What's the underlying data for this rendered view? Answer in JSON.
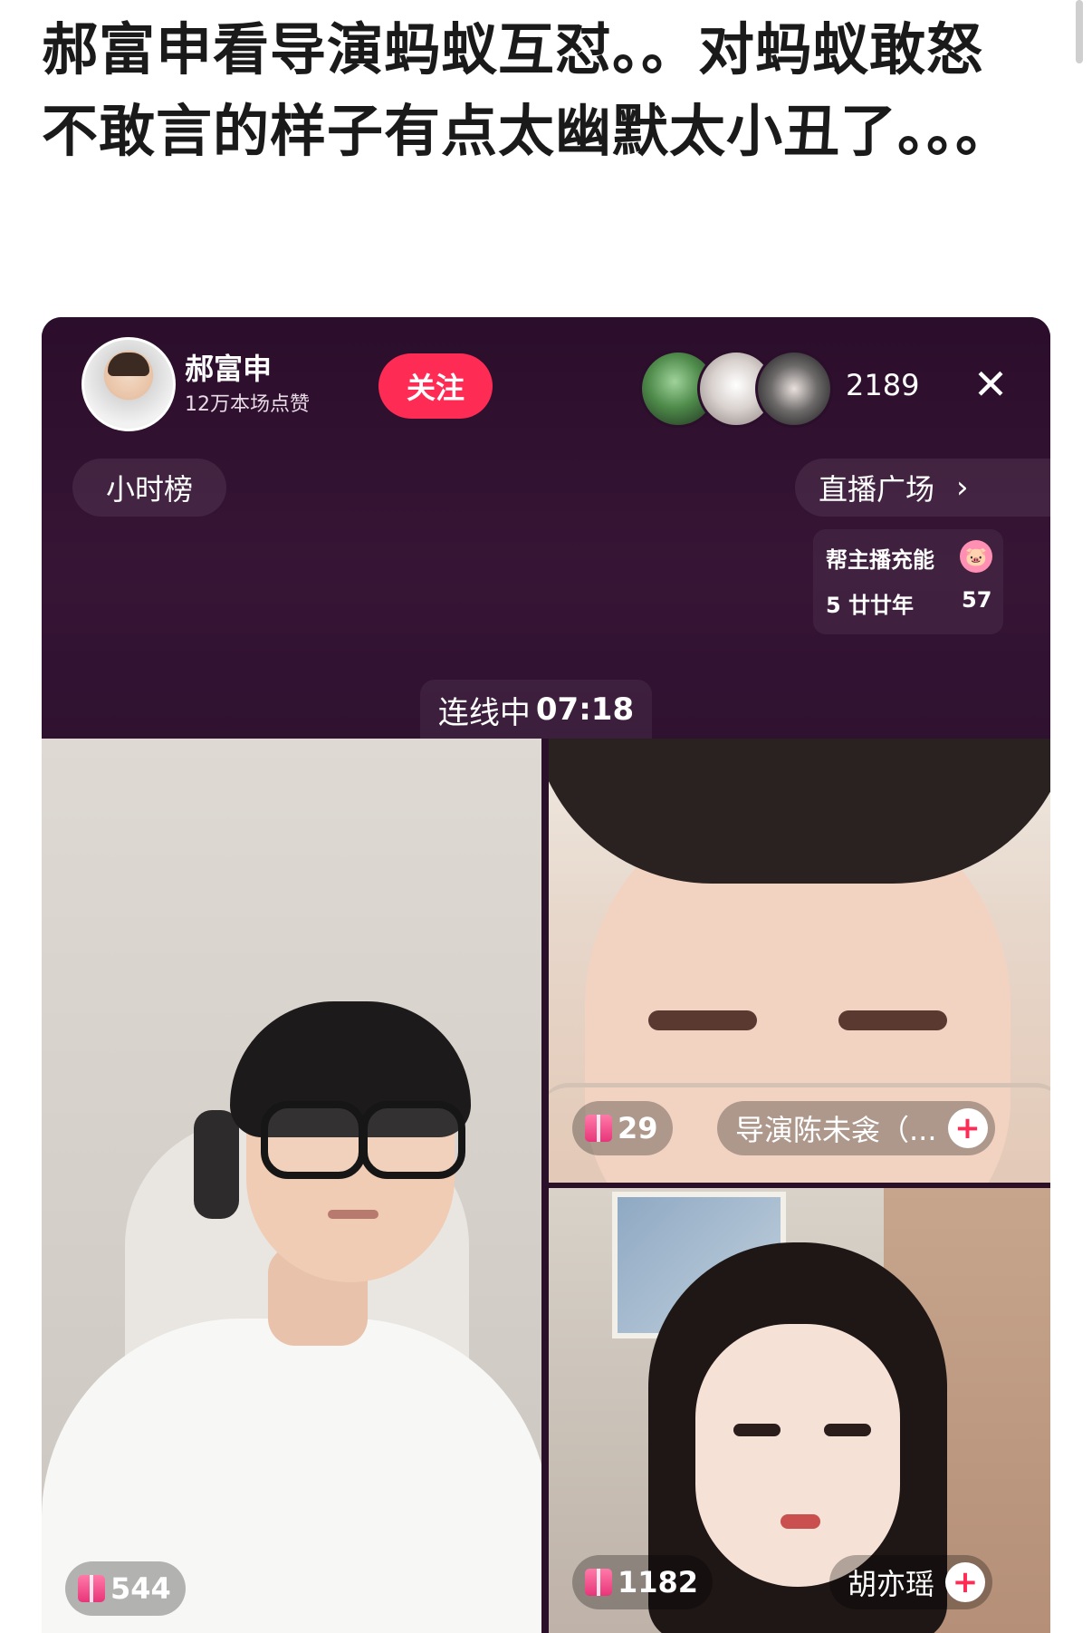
{
  "post": {
    "text": "郝富申看导演蚂蚁互怼。。对蚂蚁敢怒不敢言的样子有点太幽默太小丑了。。。"
  },
  "live": {
    "host": {
      "name": "郝富申",
      "likes": "12万本场点赞"
    },
    "follow_label": "关注",
    "viewer_count": "2189",
    "close_icon": "✕",
    "hour_rank_label": "小时榜",
    "live_square_label": "直播广场",
    "live_square_chevron": "›",
    "charge": {
      "title": "帮主播充能",
      "user": "5 廿廿年",
      "score": "57",
      "icon": "🐷"
    },
    "link": {
      "label": "连线中",
      "time": "07:18"
    },
    "panels": {
      "left": {
        "gift_count": "544"
      },
      "right_top": {
        "gift_count": "29",
        "name": "导演陈未衾（..."
      },
      "right_bottom": {
        "gift_count": "1182",
        "name": "胡亦瑶"
      }
    },
    "plus_symbol": "+"
  },
  "colors": {
    "accent_red": "#fe2c55",
    "live_bg": "#2b0e2b"
  }
}
